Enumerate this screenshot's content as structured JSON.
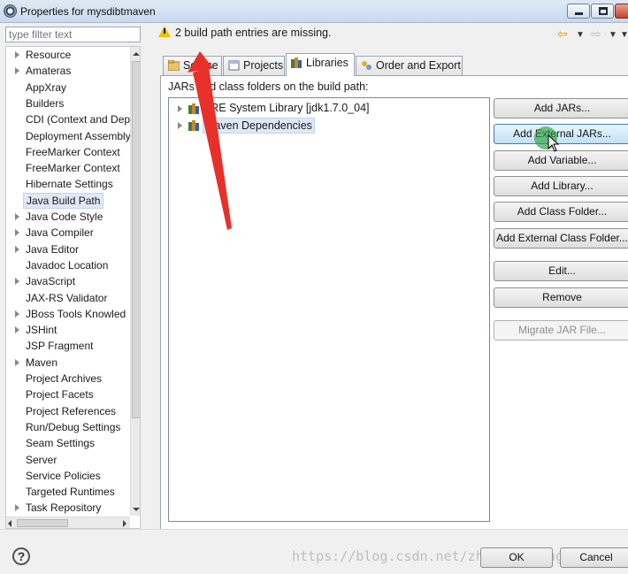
{
  "window": {
    "title": "Properties for mysdibtmaven"
  },
  "filter": {
    "placeholder": "type filter text"
  },
  "tree": {
    "items": [
      {
        "label": "Resource",
        "expandable": true
      },
      {
        "label": "Amateras",
        "expandable": true
      },
      {
        "label": "AppXray",
        "expandable": false
      },
      {
        "label": "Builders",
        "expandable": false
      },
      {
        "label": "CDI (Context and Dep",
        "expandable": false
      },
      {
        "label": "Deployment Assembly",
        "expandable": false
      },
      {
        "label": "FreeMarker Context",
        "expandable": false
      },
      {
        "label": "FreeMarker Context",
        "expandable": false
      },
      {
        "label": "Hibernate Settings",
        "expandable": false
      },
      {
        "label": "Java Build Path",
        "expandable": false,
        "selected": true
      },
      {
        "label": "Java Code Style",
        "expandable": true
      },
      {
        "label": "Java Compiler",
        "expandable": true
      },
      {
        "label": "Java Editor",
        "expandable": true
      },
      {
        "label": "Javadoc Location",
        "expandable": false
      },
      {
        "label": "JavaScript",
        "expandable": true
      },
      {
        "label": "JAX-RS Validator",
        "expandable": false
      },
      {
        "label": "JBoss Tools Knowled",
        "expandable": true
      },
      {
        "label": "JSHint",
        "expandable": true
      },
      {
        "label": "JSP Fragment",
        "expandable": false
      },
      {
        "label": "Maven",
        "expandable": true
      },
      {
        "label": "Project Archives",
        "expandable": false
      },
      {
        "label": "Project Facets",
        "expandable": false
      },
      {
        "label": "Project References",
        "expandable": false
      },
      {
        "label": "Run/Debug Settings",
        "expandable": false
      },
      {
        "label": "Seam Settings",
        "expandable": false
      },
      {
        "label": "Server",
        "expandable": false
      },
      {
        "label": "Service Policies",
        "expandable": false
      },
      {
        "label": "Targeted Runtimes",
        "expandable": false
      },
      {
        "label": "Task Repository",
        "expandable": true
      }
    ]
  },
  "header": {
    "message": "2 build path entries are missing."
  },
  "tabs": [
    {
      "label": "Source"
    },
    {
      "label": "Projects"
    },
    {
      "label": "Libraries",
      "active": true
    },
    {
      "label": "Order and Export"
    }
  ],
  "libraries": {
    "section_label": "JARs and class folders on the build path:",
    "entries": [
      {
        "label": "JRE System Library [jdk1.7.0_04]"
      },
      {
        "label": "Maven Dependencies",
        "selected": true
      }
    ]
  },
  "buttons": {
    "add_jars": "Add JARs...",
    "add_external_jars": "Add External JARs...",
    "add_variable": "Add Variable...",
    "add_library": "Add Library...",
    "add_class_folder": "Add Class Folder...",
    "add_external_class_folder": "Add External Class Folder...",
    "edit": "Edit...",
    "remove": "Remove",
    "migrate_jar": "Migrate JAR File..."
  },
  "footer": {
    "help": "?",
    "ok": "OK",
    "cancel": "Cancel",
    "watermark": "https://blog.csdn.net/zhangsuilong"
  },
  "colors": {
    "annotation_arrow": "#e8302a",
    "warning": "#f2c200",
    "cursor_highlight": "#28a03c"
  }
}
